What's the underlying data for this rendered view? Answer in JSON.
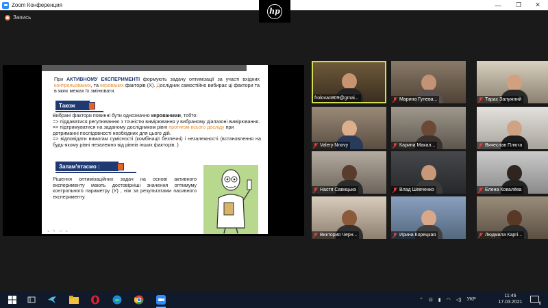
{
  "window": {
    "title": "Zoom Конференция"
  },
  "recording": {
    "label": "Запись"
  },
  "brand": {
    "logo_text": "hp"
  },
  "slide": {
    "p1": {
      "t1": "При ",
      "t2": "АКТИВНОМУ ЕКСПЕРИМЕНТІ",
      "t3": " формують задачу оптимізації за участі вхідних ",
      "t4": "контрольованих",
      "t5": ", та ",
      "t6": "керованих",
      "t7": " факторів (Х). ",
      "t8": "Д",
      "t9": "ослідник самостійно вибирає ці фактори та в яких межах їх змінювати."
    },
    "tag_also": "Також",
    "p2": {
      "line1a": "Вибрані фактори повинні бути однозначно ",
      "line1b": "керованими",
      "line1c": ", тобто:",
      "line2": "=>     піддаватися регулюванню з точністю вимірювання у вибраному діапазоні вимірювання.",
      "line3a": "=> підтримуватися на заданому дослідником рівні ",
      "line3b": "протягом всього досліду",
      "line3c": " при дотриманні послідовності необхідних для цього дій.",
      "line4": "=>    відповідати вимогам сумісності  (комбінації безпечні) і незалежності (встановлення на будь-якому рівні незалежно від рівнів інших факторів. )"
    },
    "tag_remember": "Запам'ятасмо :",
    "p3": "Рішення оптимізаційних задач на основі активного експерименту мають достовірніші значення оптимуму контрольного параметру (У) , ніж за результатами пасивного експерименту.",
    "controls": "◂ ✎ ▭ ▸"
  },
  "participants": [
    {
      "name": "frolovan809@gmai...",
      "muted": false
    },
    {
      "name": "Марина Гулева...",
      "muted": true
    },
    {
      "name": "Тарас Залужний",
      "muted": true
    },
    {
      "name": "Valery Nnovy",
      "muted": true
    },
    {
      "name": "Карина Макал...",
      "muted": true
    },
    {
      "name": "Вячеслав Плюта",
      "muted": true
    },
    {
      "name": "Настя Савицька",
      "muted": true
    },
    {
      "name": "Влад Шевченко",
      "muted": true
    },
    {
      "name": "Елена Ковалёва",
      "muted": true
    },
    {
      "name": "Виктория Черн...",
      "muted": true
    },
    {
      "name": "Ирина Корецкая",
      "muted": true
    },
    {
      "name": "Людмила Каргі...",
      "muted": true
    }
  ],
  "taskbar": {
    "language": "УКР",
    "time": "11:46",
    "date": "17.03.2021",
    "notifications": "6"
  }
}
